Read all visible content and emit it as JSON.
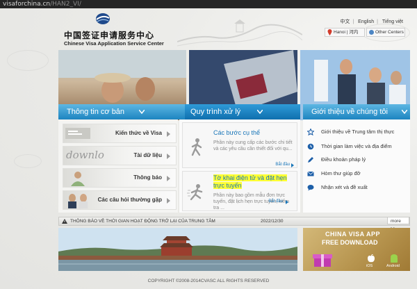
{
  "browser": {
    "url_host": "visaforchina.cn",
    "url_path": "/HAN2_VI/"
  },
  "header": {
    "logo_cn": "中国签证申请服务中心",
    "logo_en": "Chinese Visa Application Service Center",
    "languages": [
      "中文",
      "English",
      "Tiếng việt"
    ],
    "location_label": "Hanoi | 河内",
    "other_centers_label": "Other Centers"
  },
  "sections": {
    "basic_info": {
      "title": "Thông tin cơ bản",
      "items": [
        "Kiến thức về Visa",
        "Tài dữ liệu",
        "Thông báo",
        "Các câu hỏi thường gặp"
      ],
      "download_text": "downlo"
    },
    "process": {
      "title": "Quy trình xử lý",
      "cards": [
        {
          "title": "Các bước cụ thể",
          "description": "Phần này cung cấp các bước chi tiết và các yêu cầu cần thiết đối với qu...",
          "more": "Bắt đầu"
        },
        {
          "title": "Tờ khai điện tử và đặt hẹn trực tuyến",
          "description": "Phần này bao gồm mẫu đơn trực tuyến, đặt lịch hẹn trực tuyến, kiểm tra ...",
          "more": "Bắt đầu"
        }
      ]
    },
    "about": {
      "title": "Giới thiệu về chúng tôi",
      "links": [
        {
          "label": "Giới thiệu về Trung tâm thị thực",
          "icon": "star-icon"
        },
        {
          "label": "Thời gian làm việc và địa điểm",
          "icon": "clock-icon"
        },
        {
          "label": "Điều khoản pháp lý",
          "icon": "pencil-icon"
        },
        {
          "label": "Hòm thư giúp đỡ",
          "icon": "envelope-icon"
        },
        {
          "label": "Nhận xét và đề xuất",
          "icon": "chat-icon"
        }
      ]
    }
  },
  "notice": {
    "text": "THÔNG BÁO VỀ THỜI GIAN HOẠT ĐỘNG TRỞ LẠI CỦA TRUNG TÂM",
    "date": "2022/12/30",
    "more": "more >>"
  },
  "app_banner": {
    "line1": "CHINA VISA APP",
    "line2": "FREE DOWNLOAD",
    "ios": "iOS",
    "android": "Android"
  },
  "footer": {
    "copyright": "COPYRIGHT ©2008-2014CVASC ALL RIGHTS RESERVED"
  },
  "colors": {
    "accent_blue": "#1d84c0",
    "link_blue": "#1875b8",
    "highlight": "#ffff33"
  }
}
